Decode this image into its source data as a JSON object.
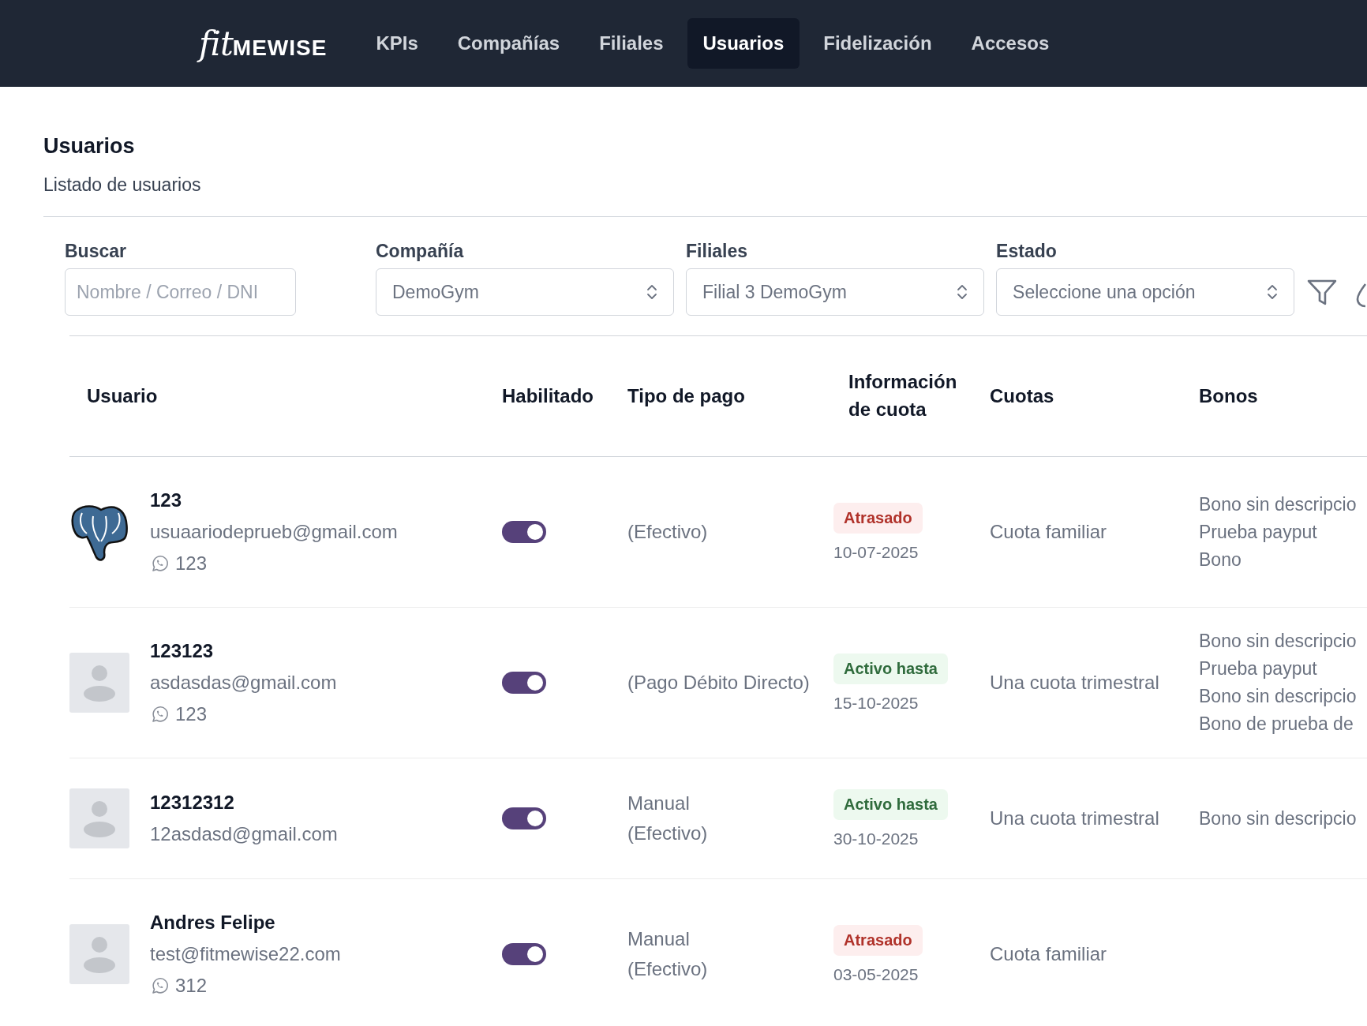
{
  "logo": {
    "script": "fit",
    "bold": "MEWISE"
  },
  "nav": [
    {
      "label": "KPIs",
      "selected": false
    },
    {
      "label": "Compañías",
      "selected": false
    },
    {
      "label": "Filiales",
      "selected": false
    },
    {
      "label": "Usuarios",
      "selected": true
    },
    {
      "label": "Fidelización",
      "selected": false
    },
    {
      "label": "Accesos",
      "selected": false
    }
  ],
  "page": {
    "title": "Usuarios",
    "subtitle": "Listado de usuarios"
  },
  "filters": [
    {
      "kind": "text",
      "label": "Buscar",
      "placeholder": "Nombre / Correo / DNI"
    },
    {
      "kind": "select",
      "label": "Compañía",
      "value": "DemoGym"
    },
    {
      "kind": "select",
      "label": "Filiales",
      "value": "Filial 3 DemoGym"
    },
    {
      "kind": "select",
      "label": "Estado",
      "placeholder": "Seleccione una opción"
    }
  ],
  "table": {
    "columns": [
      "Usuario",
      "Habilitado",
      "Tipo de pago",
      "Información de cuota",
      "Cuotas",
      "Bonos"
    ],
    "rows": [
      {
        "kind": "photo",
        "name": "123",
        "email": "usuaariodeprueb@gmail.com",
        "phone": "123",
        "enabled": true,
        "payment": [
          "(Efectivo)"
        ],
        "status": {
          "kind": "late",
          "label": "Atrasado"
        },
        "date": "10-07-2025",
        "quota": "Cuota familiar",
        "bonos": [
          "Bono sin descripcio",
          "Prueba payput",
          "Bono"
        ]
      },
      {
        "kind": "default",
        "name": "123123",
        "email": "asdasdas@gmail.com",
        "phone": "123",
        "enabled": true,
        "payment": [
          "(Pago Débito Directo)"
        ],
        "status": {
          "kind": "active",
          "label": "Activo hasta"
        },
        "date": "15-10-2025",
        "quota": "Una cuota trimestral",
        "bonos": [
          "Bono sin descripcio",
          "Prueba payput",
          "Bono sin descripcio",
          "Bono de prueba de"
        ]
      },
      {
        "kind": "default",
        "name": "12312312",
        "email": "12asdasd@gmail.com",
        "enabled": true,
        "payment": [
          "Manual",
          "(Efectivo)"
        ],
        "status": {
          "kind": "active",
          "label": "Activo hasta"
        },
        "date": "30-10-2025",
        "quota": "Una cuota trimestral",
        "bonos": [
          "Bono sin descripcio"
        ]
      },
      {
        "kind": "default",
        "name": "Andres Felipe",
        "email": "test@fitmewise22.com",
        "phone": "312",
        "enabled": true,
        "payment": [
          "Manual",
          "(Efectivo)"
        ],
        "status": {
          "kind": "late",
          "label": "Atrasado"
        },
        "date": "03-05-2025",
        "quota": "Cuota familiar"
      }
    ]
  }
}
